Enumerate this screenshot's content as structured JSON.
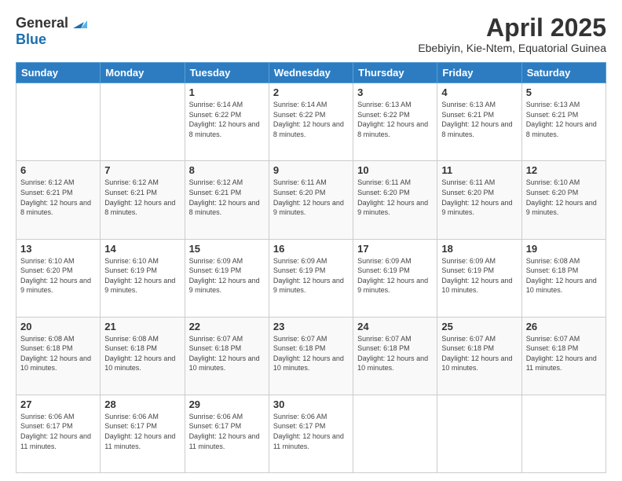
{
  "header": {
    "logo_general": "General",
    "logo_blue": "Blue",
    "month_title": "April 2025",
    "location": "Ebebiyin, Kie-Ntem, Equatorial Guinea"
  },
  "days_of_week": [
    "Sunday",
    "Monday",
    "Tuesday",
    "Wednesday",
    "Thursday",
    "Friday",
    "Saturday"
  ],
  "weeks": [
    [
      {
        "day": "",
        "info": ""
      },
      {
        "day": "",
        "info": ""
      },
      {
        "day": "1",
        "info": "Sunrise: 6:14 AM\nSunset: 6:22 PM\nDaylight: 12 hours and 8 minutes."
      },
      {
        "day": "2",
        "info": "Sunrise: 6:14 AM\nSunset: 6:22 PM\nDaylight: 12 hours and 8 minutes."
      },
      {
        "day": "3",
        "info": "Sunrise: 6:13 AM\nSunset: 6:22 PM\nDaylight: 12 hours and 8 minutes."
      },
      {
        "day": "4",
        "info": "Sunrise: 6:13 AM\nSunset: 6:21 PM\nDaylight: 12 hours and 8 minutes."
      },
      {
        "day": "5",
        "info": "Sunrise: 6:13 AM\nSunset: 6:21 PM\nDaylight: 12 hours and 8 minutes."
      }
    ],
    [
      {
        "day": "6",
        "info": "Sunrise: 6:12 AM\nSunset: 6:21 PM\nDaylight: 12 hours and 8 minutes."
      },
      {
        "day": "7",
        "info": "Sunrise: 6:12 AM\nSunset: 6:21 PM\nDaylight: 12 hours and 8 minutes."
      },
      {
        "day": "8",
        "info": "Sunrise: 6:12 AM\nSunset: 6:21 PM\nDaylight: 12 hours and 8 minutes."
      },
      {
        "day": "9",
        "info": "Sunrise: 6:11 AM\nSunset: 6:20 PM\nDaylight: 12 hours and 9 minutes."
      },
      {
        "day": "10",
        "info": "Sunrise: 6:11 AM\nSunset: 6:20 PM\nDaylight: 12 hours and 9 minutes."
      },
      {
        "day": "11",
        "info": "Sunrise: 6:11 AM\nSunset: 6:20 PM\nDaylight: 12 hours and 9 minutes."
      },
      {
        "day": "12",
        "info": "Sunrise: 6:10 AM\nSunset: 6:20 PM\nDaylight: 12 hours and 9 minutes."
      }
    ],
    [
      {
        "day": "13",
        "info": "Sunrise: 6:10 AM\nSunset: 6:20 PM\nDaylight: 12 hours and 9 minutes."
      },
      {
        "day": "14",
        "info": "Sunrise: 6:10 AM\nSunset: 6:19 PM\nDaylight: 12 hours and 9 minutes."
      },
      {
        "day": "15",
        "info": "Sunrise: 6:09 AM\nSunset: 6:19 PM\nDaylight: 12 hours and 9 minutes."
      },
      {
        "day": "16",
        "info": "Sunrise: 6:09 AM\nSunset: 6:19 PM\nDaylight: 12 hours and 9 minutes."
      },
      {
        "day": "17",
        "info": "Sunrise: 6:09 AM\nSunset: 6:19 PM\nDaylight: 12 hours and 9 minutes."
      },
      {
        "day": "18",
        "info": "Sunrise: 6:09 AM\nSunset: 6:19 PM\nDaylight: 12 hours and 10 minutes."
      },
      {
        "day": "19",
        "info": "Sunrise: 6:08 AM\nSunset: 6:18 PM\nDaylight: 12 hours and 10 minutes."
      }
    ],
    [
      {
        "day": "20",
        "info": "Sunrise: 6:08 AM\nSunset: 6:18 PM\nDaylight: 12 hours and 10 minutes."
      },
      {
        "day": "21",
        "info": "Sunrise: 6:08 AM\nSunset: 6:18 PM\nDaylight: 12 hours and 10 minutes."
      },
      {
        "day": "22",
        "info": "Sunrise: 6:07 AM\nSunset: 6:18 PM\nDaylight: 12 hours and 10 minutes."
      },
      {
        "day": "23",
        "info": "Sunrise: 6:07 AM\nSunset: 6:18 PM\nDaylight: 12 hours and 10 minutes."
      },
      {
        "day": "24",
        "info": "Sunrise: 6:07 AM\nSunset: 6:18 PM\nDaylight: 12 hours and 10 minutes."
      },
      {
        "day": "25",
        "info": "Sunrise: 6:07 AM\nSunset: 6:18 PM\nDaylight: 12 hours and 10 minutes."
      },
      {
        "day": "26",
        "info": "Sunrise: 6:07 AM\nSunset: 6:18 PM\nDaylight: 12 hours and 11 minutes."
      }
    ],
    [
      {
        "day": "27",
        "info": "Sunrise: 6:06 AM\nSunset: 6:17 PM\nDaylight: 12 hours and 11 minutes."
      },
      {
        "day": "28",
        "info": "Sunrise: 6:06 AM\nSunset: 6:17 PM\nDaylight: 12 hours and 11 minutes."
      },
      {
        "day": "29",
        "info": "Sunrise: 6:06 AM\nSunset: 6:17 PM\nDaylight: 12 hours and 11 minutes."
      },
      {
        "day": "30",
        "info": "Sunrise: 6:06 AM\nSunset: 6:17 PM\nDaylight: 12 hours and 11 minutes."
      },
      {
        "day": "",
        "info": ""
      },
      {
        "day": "",
        "info": ""
      },
      {
        "day": "",
        "info": ""
      }
    ]
  ]
}
